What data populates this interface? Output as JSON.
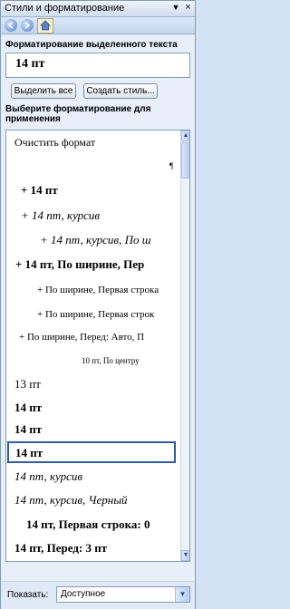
{
  "pane": {
    "title": "Стили и форматирование",
    "dropdown_glyph": "▼",
    "close_glyph": "×"
  },
  "nav": {
    "back_icon": "back-arrow-icon",
    "forward_icon": "forward-arrow-icon",
    "home_icon": "home-icon"
  },
  "current": {
    "label": "Форматирование выделенного текста",
    "value": "14 пт"
  },
  "buttons": {
    "select_all": "Выделить все",
    "create_style": "Создать стиль..."
  },
  "list_label": "Выберите форматирование для применения",
  "paragraph_mark": "¶",
  "items": [
    {
      "text": "Очистить формат"
    },
    {
      "text": "+ 14 пт"
    },
    {
      "text": "+ 14 пт, курсив"
    },
    {
      "text": "+ 14 пт, курсив, По ш"
    },
    {
      "text": "+ 14 пт, По ширине, Пер"
    },
    {
      "text": "+ По ширине, Первая строка"
    },
    {
      "text": "+ По ширине, Первая строк"
    },
    {
      "text": "+ По ширине, Перед:  Авто, П"
    },
    {
      "text": "10 пт, По центру"
    },
    {
      "text": "13 пт"
    },
    {
      "text": "14 пт"
    },
    {
      "text": "14 пт"
    },
    {
      "text": "14 пт"
    },
    {
      "text": "14 пт, курсив"
    },
    {
      "text": "14 пт, курсив, Черный"
    },
    {
      "text": "14 пт, Первая строка:  0"
    },
    {
      "text": "14 пт, Перед:  3 пт"
    }
  ],
  "scrollbar": {
    "up_glyph": "▲",
    "down_glyph": "▼"
  },
  "footer": {
    "show_label": "Показать:",
    "show_value": "Доступное",
    "dd_glyph": "▼"
  },
  "colors": {
    "selection_border": "#315ea1",
    "pane_bg": "#e8eff9"
  }
}
